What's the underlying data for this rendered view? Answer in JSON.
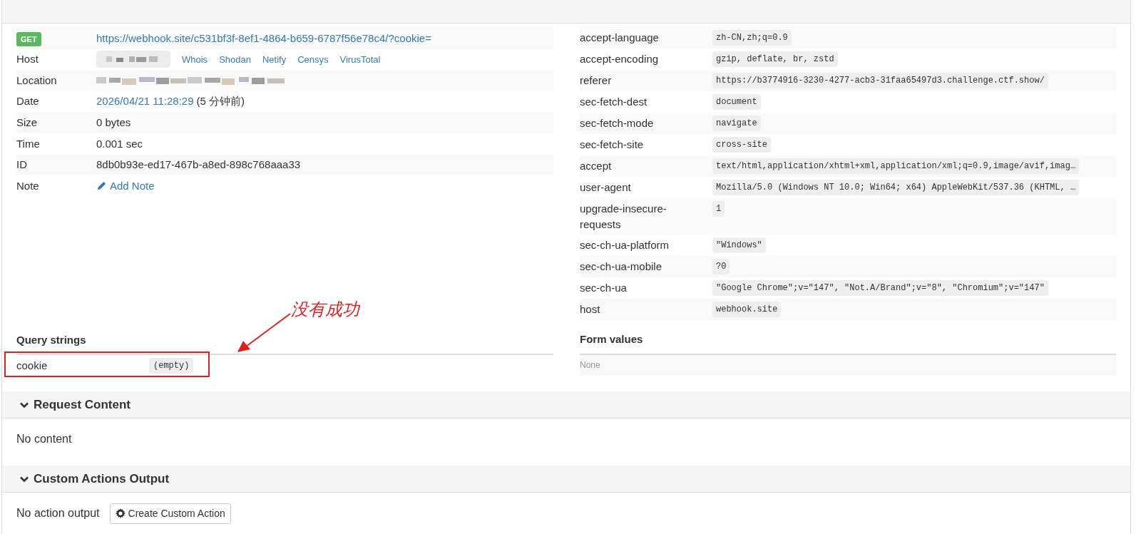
{
  "request": {
    "method": "GET",
    "url": "https://webhook.site/c531bf3f-8ef1-4864-b659-6787f56e78c4/?cookie=",
    "details": [
      {
        "kind": "host",
        "label": "Host",
        "links": [
          "Whois",
          "Shodan",
          "Netify",
          "Censys",
          "VirusTotal"
        ]
      },
      {
        "kind": "redacted",
        "label": "Location"
      },
      {
        "kind": "date",
        "label": "Date",
        "value": "2026/04/21 11:28:29",
        "suffix": "(5 分钟前)"
      },
      {
        "kind": "text",
        "label": "Size",
        "value": "0 bytes"
      },
      {
        "kind": "text",
        "label": "Time",
        "value": "0.001 sec"
      },
      {
        "kind": "text",
        "label": "ID",
        "value": "8db0b93e-ed17-467b-a8ed-898c768aaa33"
      },
      {
        "kind": "note",
        "label": "Note",
        "value": "Add Note"
      }
    ]
  },
  "headers": [
    {
      "name": "accept-language",
      "value": "zh-CN,zh;q=0.9"
    },
    {
      "name": "accept-encoding",
      "value": "gzip, deflate, br, zstd"
    },
    {
      "name": "referer",
      "value": "https://b3774916-3230-4277-acb3-31faa65497d3.challenge.ctf.show/"
    },
    {
      "name": "sec-fetch-dest",
      "value": "document"
    },
    {
      "name": "sec-fetch-mode",
      "value": "navigate"
    },
    {
      "name": "sec-fetch-site",
      "value": "cross-site"
    },
    {
      "name": "accept",
      "value": "text/html,application/xhtml+xml,application/xml;q=0.9,image/avif,imag…"
    },
    {
      "name": "user-agent",
      "value": "Mozilla/5.0 (Windows NT 10.0; Win64; x64) AppleWebKit/537.36 (KHTML, …"
    },
    {
      "name": "upgrade-insecure-requests",
      "value": "1"
    },
    {
      "name": "sec-ch-ua-platform",
      "value": "\"Windows\""
    },
    {
      "name": "sec-ch-ua-mobile",
      "value": "?0"
    },
    {
      "name": "sec-ch-ua",
      "value": "\"Google Chrome\";v=\"147\", \"Not.A/Brand\";v=\"8\", \"Chromium\";v=\"147\""
    },
    {
      "name": "host",
      "value": "webhook.site"
    }
  ],
  "query_strings": {
    "title": "Query strings",
    "rows": [
      {
        "name": "cookie",
        "value": "(empty)"
      }
    ]
  },
  "form_values": {
    "title": "Form values",
    "empty_text": "None"
  },
  "annotation": {
    "text": "没有成功"
  },
  "sections": [
    {
      "title": "Request Content",
      "expanded": true,
      "content": "No content"
    },
    {
      "title": "Custom Actions Output",
      "expanded": true,
      "content": "No action output",
      "button": "Create Custom Action"
    }
  ]
}
